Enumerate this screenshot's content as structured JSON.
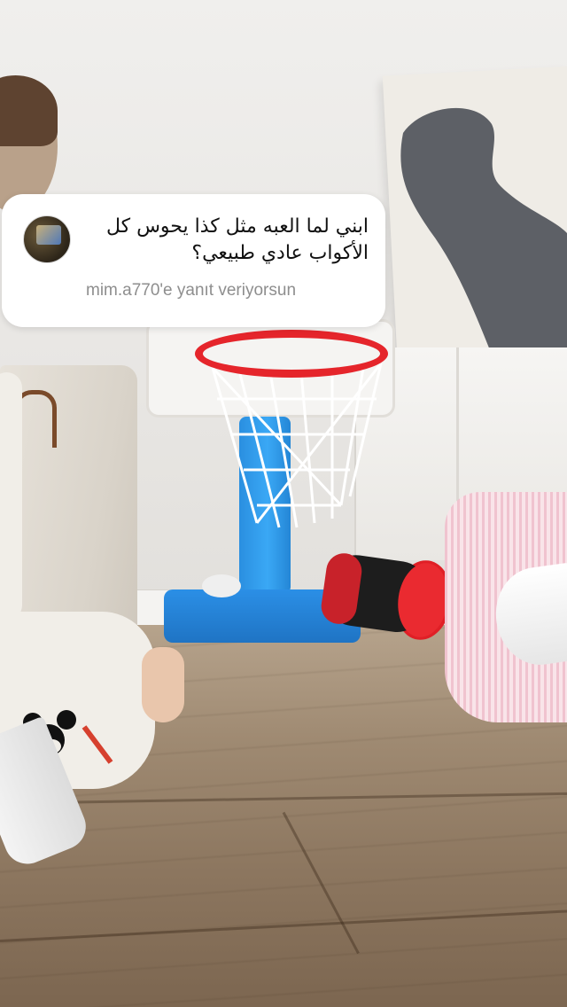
{
  "reply_sticker": {
    "question": "ابني لما العبه مثل كذا يحوس كل الأكواب عادي طبيعي؟",
    "reply_meta": "mim.a770'e yanıt veriyorsun"
  },
  "colors": {
    "card_background": "#ffffff",
    "question_text": "#111111",
    "meta_text": "#8e8e8e",
    "hoop_rim": "#e5252b",
    "hoop_stand": "#2a8fe0"
  }
}
